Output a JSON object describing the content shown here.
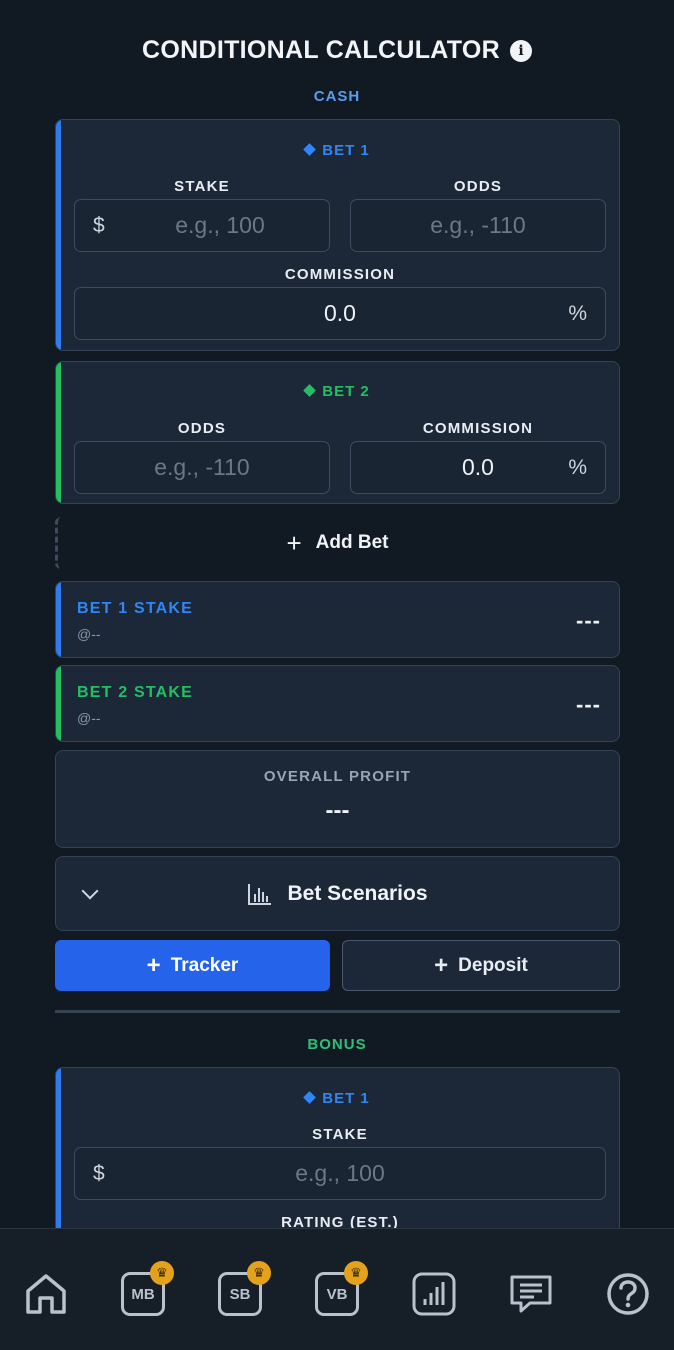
{
  "header": {
    "title": "CONDITIONAL CALCULATOR",
    "info_icon": "info-icon"
  },
  "cash": {
    "label": "CASH",
    "bet1": {
      "title": "BET 1",
      "stake_label": "STAKE",
      "stake_prefix": "$",
      "stake_placeholder": "e.g., 100",
      "odds_label": "ODDS",
      "odds_placeholder": "e.g., -110",
      "commission_label": "COMMISSION",
      "commission_value": "0.0",
      "commission_suffix": "%"
    },
    "bet2": {
      "title": "BET 2",
      "odds_label": "ODDS",
      "odds_placeholder": "e.g., -110",
      "commission_label": "COMMISSION",
      "commission_value": "0.0",
      "commission_suffix": "%"
    },
    "add_bet": "Add Bet",
    "results": {
      "bet1_stake_label": "BET 1 STAKE",
      "bet1_stake_sub": "@--",
      "bet1_stake_value": "---",
      "bet2_stake_label": "BET 2 STAKE",
      "bet2_stake_sub": "@--",
      "bet2_stake_value": "---",
      "profit_label": "OVERALL PROFIT",
      "profit_value": "---"
    },
    "scenarios_label": "Bet Scenarios",
    "tracker_button": "Tracker",
    "deposit_button": "Deposit"
  },
  "bonus": {
    "label": "BONUS",
    "bet1": {
      "title": "BET 1",
      "stake_label": "STAKE",
      "stake_prefix": "$",
      "stake_placeholder": "e.g., 100",
      "rating_label": "RATING (EST.)"
    }
  },
  "nav": {
    "items": [
      {
        "name": "home-icon"
      },
      {
        "name": "mb-icon",
        "label": "MB",
        "premium": true
      },
      {
        "name": "sb-icon",
        "label": "SB",
        "premium": true
      },
      {
        "name": "vb-icon",
        "label": "VB",
        "premium": true
      },
      {
        "name": "stats-icon"
      },
      {
        "name": "chat-icon"
      },
      {
        "name": "help-icon"
      }
    ]
  },
  "colors": {
    "background": "#111a22",
    "card": "#1c2837",
    "bet1_accent": "#2f7cf0",
    "bet2_accent": "#22bf63",
    "primary_button": "#2563eb",
    "crown": "#e4a21c"
  }
}
